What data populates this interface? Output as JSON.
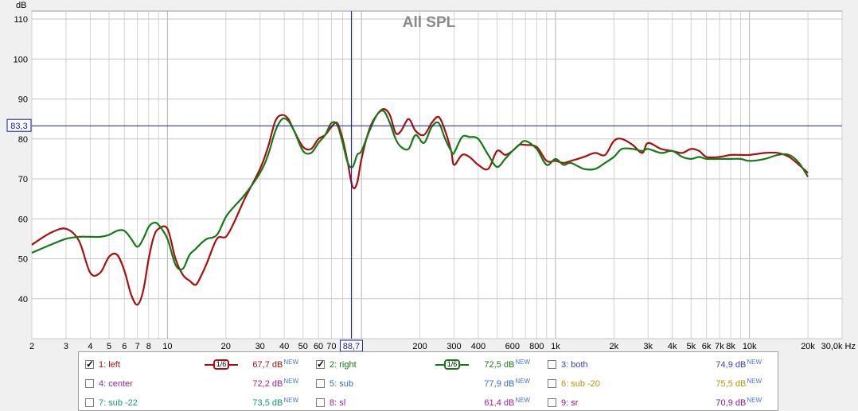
{
  "chart_data": {
    "type": "line",
    "title": "All SPL",
    "ylabel": "dB",
    "xlabel": "Hz",
    "xscale": "log",
    "xlim": [
      2,
      30000
    ],
    "ylim": [
      30,
      112
    ],
    "grid": true,
    "x_ticks": [
      {
        "v": 2,
        "label": "2"
      },
      {
        "v": 3,
        "label": "3"
      },
      {
        "v": 4,
        "label": "4"
      },
      {
        "v": 5,
        "label": "5"
      },
      {
        "v": 6,
        "label": "6"
      },
      {
        "v": 7,
        "label": "7"
      },
      {
        "v": 8,
        "label": "8"
      },
      {
        "v": 10,
        "label": "10"
      },
      {
        "v": 20,
        "label": "20"
      },
      {
        "v": 30,
        "label": "30"
      },
      {
        "v": 40,
        "label": "40"
      },
      {
        "v": 50,
        "label": "50"
      },
      {
        "v": 60,
        "label": "60"
      },
      {
        "v": 70,
        "label": "70"
      },
      {
        "v": 200,
        "label": "200"
      },
      {
        "v": 300,
        "label": "300"
      },
      {
        "v": 400,
        "label": "400"
      },
      {
        "v": 600,
        "label": "600"
      },
      {
        "v": 800,
        "label": "800"
      },
      {
        "v": 1000,
        "label": "1k"
      },
      {
        "v": 2000,
        "label": "2k"
      },
      {
        "v": 3000,
        "label": "3k"
      },
      {
        "v": 4000,
        "label": "4k"
      },
      {
        "v": 5000,
        "label": "5k"
      },
      {
        "v": 6000,
        "label": "6k"
      },
      {
        "v": 7000,
        "label": "7k"
      },
      {
        "v": 8000,
        "label": "8k"
      },
      {
        "v": 10000,
        "label": "10k"
      },
      {
        "v": 20000,
        "label": "20k"
      },
      {
        "v": 30000,
        "label": "30,0k Hz"
      }
    ],
    "y_ticks": [
      40,
      50,
      60,
      70,
      80,
      90,
      100,
      110
    ],
    "cursor": {
      "x": 88.7,
      "y": 83.3,
      "x_label": "88,7",
      "y_label": "83,3"
    },
    "series": [
      {
        "name": "1: left",
        "color": "#a81010",
        "x": [
          2,
          2.5,
          3,
          3.5,
          4,
          4.5,
          5,
          5.5,
          6,
          6.5,
          7,
          7.5,
          8,
          8.5,
          9,
          10,
          11,
          12,
          13,
          14,
          15,
          16,
          18,
          20,
          22,
          25,
          30,
          33,
          36,
          39,
          42,
          45,
          50,
          55,
          60,
          65,
          70,
          75,
          80,
          85,
          90,
          95,
          100,
          110,
          120,
          130,
          140,
          150,
          160,
          175,
          190,
          210,
          230,
          250,
          270,
          290,
          300,
          330,
          360,
          400,
          450,
          500,
          550,
          600,
          650,
          700,
          800,
          900,
          1000,
          1100,
          1200,
          1400,
          1600,
          1800,
          2000,
          2200,
          2500,
          2800,
          3000,
          3500,
          4000,
          4500,
          5000,
          5500,
          6000,
          7000,
          8000,
          9000,
          10000,
          12000,
          14000,
          16000,
          18000,
          20000
        ],
        "y": [
          53.5,
          56.5,
          57.5,
          54.5,
          46.5,
          46.5,
          50.5,
          51,
          47,
          41,
          38.5,
          42,
          50,
          55.5,
          57.5,
          57.5,
          50,
          46,
          44.5,
          43.5,
          46,
          49,
          55,
          55.5,
          59,
          65,
          72.5,
          78,
          84.5,
          86,
          85,
          82,
          78,
          77.5,
          80,
          81,
          83,
          84,
          80,
          74,
          68,
          69,
          75,
          82.5,
          86,
          87.5,
          86,
          81.5,
          82,
          85,
          82,
          81,
          84,
          85.5,
          82,
          77,
          73.5,
          76,
          75.5,
          73.5,
          72.5,
          77,
          76,
          77,
          78.5,
          78.5,
          78,
          74.5,
          74.5,
          74,
          74.5,
          75.5,
          76.5,
          76,
          79.5,
          80,
          78.5,
          76.5,
          79,
          77.5,
          77,
          76.5,
          77.5,
          77,
          75.5,
          75.5,
          76,
          76,
          76,
          76.5,
          76.5,
          75.5,
          73.5,
          71.5
        ]
      },
      {
        "name": "2: right",
        "color": "#157a15",
        "x": [
          2,
          2.5,
          3,
          3.5,
          4,
          4.5,
          5,
          5.5,
          6,
          6.5,
          7,
          7.5,
          8,
          8.5,
          9,
          10,
          11,
          12,
          13,
          14,
          15,
          16,
          18,
          20,
          22,
          25,
          30,
          33,
          36,
          39,
          42,
          45,
          50,
          55,
          60,
          65,
          70,
          75,
          80,
          85,
          90,
          95,
          100,
          110,
          120,
          130,
          140,
          150,
          160,
          175,
          190,
          210,
          230,
          250,
          270,
          290,
          300,
          330,
          360,
          400,
          450,
          500,
          550,
          600,
          650,
          700,
          800,
          900,
          1000,
          1100,
          1200,
          1400,
          1600,
          1800,
          2000,
          2200,
          2500,
          2800,
          3000,
          3500,
          4000,
          4500,
          5000,
          5500,
          6000,
          7000,
          8000,
          9000,
          10000,
          12000,
          14000,
          16000,
          18000,
          20000
        ],
        "y": [
          51.5,
          53.5,
          55,
          55.5,
          55.5,
          55.5,
          56,
          57,
          57,
          55,
          53,
          55,
          58,
          59,
          58.5,
          55,
          48.5,
          47.5,
          51,
          52.5,
          54,
          55,
          56,
          60.5,
          63,
          66,
          71.5,
          76,
          82,
          85,
          84.5,
          82,
          77,
          76.5,
          79,
          81,
          84,
          83.5,
          79,
          74,
          73,
          76,
          77,
          82,
          86,
          87,
          84,
          80,
          78,
          77.5,
          81,
          79,
          83,
          84,
          80,
          77,
          76.5,
          80.5,
          80.5,
          80,
          76,
          73,
          75,
          77,
          78.5,
          79.5,
          77.5,
          73.5,
          75,
          73.5,
          74,
          72.5,
          72.5,
          74,
          75.5,
          77.5,
          77.5,
          77,
          77.5,
          76.5,
          77,
          75.5,
          75,
          75.5,
          75,
          75,
          75,
          75,
          74.5,
          75,
          76,
          76,
          74,
          70.5
        ]
      }
    ]
  },
  "legend": {
    "items": [
      {
        "label": "1: left",
        "value": "67,7 dB",
        "badge": "NEW",
        "checked": true,
        "color": "#a81010",
        "smoothing": "1/6"
      },
      {
        "label": "2: right",
        "value": "72,5 dB",
        "badge": "NEW",
        "checked": true,
        "color": "#157a15",
        "smoothing": "1/6"
      },
      {
        "label": "3: both",
        "value": "74,9 dB",
        "badge": "NEW",
        "checked": false,
        "color": "#3f3fb0"
      },
      {
        "label": "4: center",
        "value": "72,2 dB",
        "badge": "NEW",
        "checked": false,
        "color": "#a0209a"
      },
      {
        "label": "5: sub",
        "value": "77,9 dB",
        "badge": "NEW",
        "checked": false,
        "color": "#2c6fbf"
      },
      {
        "label": "6: sub -20",
        "value": "75,5 dB",
        "badge": "NEW",
        "checked": false,
        "color": "#b8940a"
      },
      {
        "label": "7: sub -22",
        "value": "73,5 dB",
        "badge": "NEW",
        "checked": false,
        "color": "#13957a"
      },
      {
        "label": "8: sl",
        "value": "61,4 dB",
        "badge": "NEW",
        "checked": false,
        "color": "#a0209a"
      },
      {
        "label": "9: sr",
        "value": "70,9 dB",
        "badge": "NEW",
        "checked": false,
        "color": "#8a2080"
      }
    ]
  }
}
